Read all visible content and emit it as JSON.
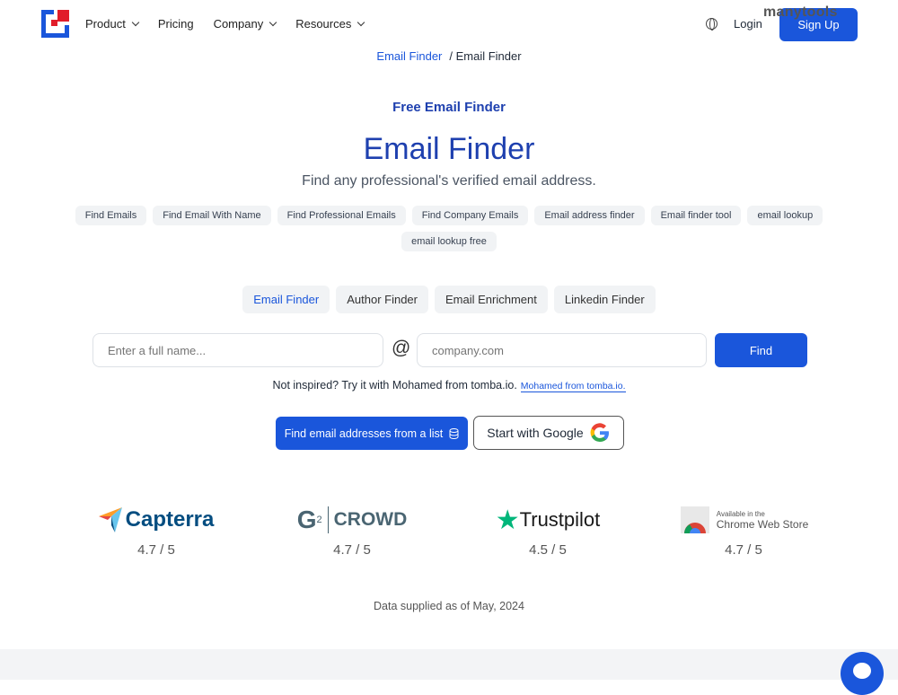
{
  "nav": {
    "items": [
      "Product",
      "Pricing",
      "Company",
      "Resources"
    ],
    "login": "Login",
    "signup": "Sign Up",
    "watermark": "manytools"
  },
  "breadcrumb": {
    "link": "Email Finder",
    "current": "/ Email Finder"
  },
  "hero": {
    "eyebrow": "Free Email Finder",
    "title": "Email Finder",
    "subtitle": "Find any professional's verified email address."
  },
  "tags": [
    "Find Emails",
    "Find Email With Name",
    "Find Professional Emails",
    "Find Company Emails",
    "Email address finder",
    "Email finder tool",
    "email lookup",
    "email lookup free"
  ],
  "tabs": [
    "Email Finder",
    "Author Finder",
    "Email Enrichment",
    "Linkedin Finder"
  ],
  "search": {
    "name_placeholder": "Enter a full name...",
    "at": "@",
    "domain_placeholder": "company.com",
    "find": "Find"
  },
  "hint": {
    "text": "Not inspired? Try it with Mohamed from tomba.io.",
    "link": "Mohamed from tomba.io."
  },
  "actions": {
    "list": "Find email addresses from a list",
    "google": "Start with Google"
  },
  "ratings": [
    {
      "name": "Capterra",
      "score": "4.7 / 5"
    },
    {
      "name": "CROWD",
      "score": "4.7 / 5"
    },
    {
      "name": "Trustpilot",
      "score": "4.5 / 5"
    },
    {
      "name": "Chrome Web Store",
      "small": "Available in the",
      "score": "4.7 / 5"
    }
  ],
  "supplied": "Data supplied as of May, 2024",
  "colors": {
    "primary": "#1a56db",
    "heading": "#1e40af"
  }
}
